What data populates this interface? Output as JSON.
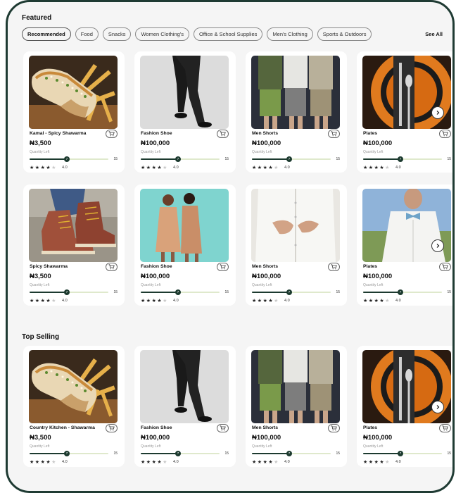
{
  "featured": {
    "title": "Featured",
    "see_all": "See All",
    "chips": [
      {
        "label": "Recommended",
        "active": true
      },
      {
        "label": "Food",
        "active": false
      },
      {
        "label": "Snacks",
        "active": false
      },
      {
        "label": "Women Clothing's",
        "active": false
      },
      {
        "label": "Office & School Supplies",
        "active": false
      },
      {
        "label": "Men's Clothing",
        "active": false
      },
      {
        "label": "Sports & Outdoors",
        "active": false
      }
    ],
    "rows": [
      [
        {
          "name": "Kamal - Spicy Shawarma",
          "price": "₦3,500",
          "qty_label": "Quantity Left",
          "qty_current": "7",
          "qty_max": "15",
          "rating": "4.0",
          "image": "shawarma"
        },
        {
          "name": "Fashion Shoe",
          "price": "₦100,000",
          "qty_label": "Quantity Left",
          "qty_current": "7",
          "qty_max": "15",
          "rating": "4.0",
          "image": "trousers"
        },
        {
          "name": "Men Shorts",
          "price": "₦100,000",
          "qty_label": "Quantity Left",
          "qty_current": "7",
          "qty_max": "15",
          "rating": "4.0",
          "image": "shorts"
        },
        {
          "name": "Plates",
          "price": "₦100,000",
          "qty_label": "Quantity Left",
          "qty_current": "7",
          "qty_max": "15",
          "rating": "4.0",
          "image": "plates"
        }
      ],
      [
        {
          "name": "Spicy Shawarma",
          "price": "₦3,500",
          "qty_label": "Quantity Left",
          "qty_current": "7",
          "qty_max": "15",
          "rating": "4.0",
          "image": "boots"
        },
        {
          "name": "Fashion Shoe",
          "price": "₦100,000",
          "qty_label": "Quantity Left",
          "qty_current": "7",
          "qty_max": "15",
          "rating": "4.0",
          "image": "women"
        },
        {
          "name": "Men Shorts",
          "price": "₦100,000",
          "qty_label": "Quantity Left",
          "qty_current": "7",
          "qty_max": "15",
          "rating": "4.0",
          "image": "shirt"
        },
        {
          "name": "Plates",
          "price": "₦100,000",
          "qty_label": "Quantity Left",
          "qty_current": "7",
          "qty_max": "15",
          "rating": "4.0",
          "image": "bowtie"
        }
      ]
    ]
  },
  "top_selling": {
    "title": "Top Selling",
    "rows": [
      [
        {
          "name": "Country Kitchen - Shawarma",
          "price": "₦3,500",
          "qty_label": "Quantity Left",
          "qty_current": "7",
          "qty_max": "15",
          "rating": "4.0",
          "image": "shawarma"
        },
        {
          "name": "Fashion Shoe",
          "price": "₦100,000",
          "qty_label": "Quantity Left",
          "qty_current": "7",
          "qty_max": "15",
          "rating": "4.0",
          "image": "trousers"
        },
        {
          "name": "Men Shorts",
          "price": "₦100,000",
          "qty_label": "Quantity Left",
          "qty_current": "7",
          "qty_max": "15",
          "rating": "4.0",
          "image": "shorts"
        },
        {
          "name": "Plates",
          "price": "₦100,000",
          "qty_label": "Quantity Left",
          "qty_current": "7",
          "qty_max": "15",
          "rating": "4.0",
          "image": "plates"
        }
      ]
    ]
  },
  "ui": {
    "stars_filled": 4,
    "stars_total": 5,
    "quantity_fraction": 0.47,
    "icons": {
      "cart": "cart-icon",
      "next": "chevron-right-icon",
      "star": "star-icon"
    },
    "colors": {
      "frame": "#1f3b33",
      "bar_fill": "#1c3a2f",
      "bar_track": "#dfe9cc"
    }
  }
}
